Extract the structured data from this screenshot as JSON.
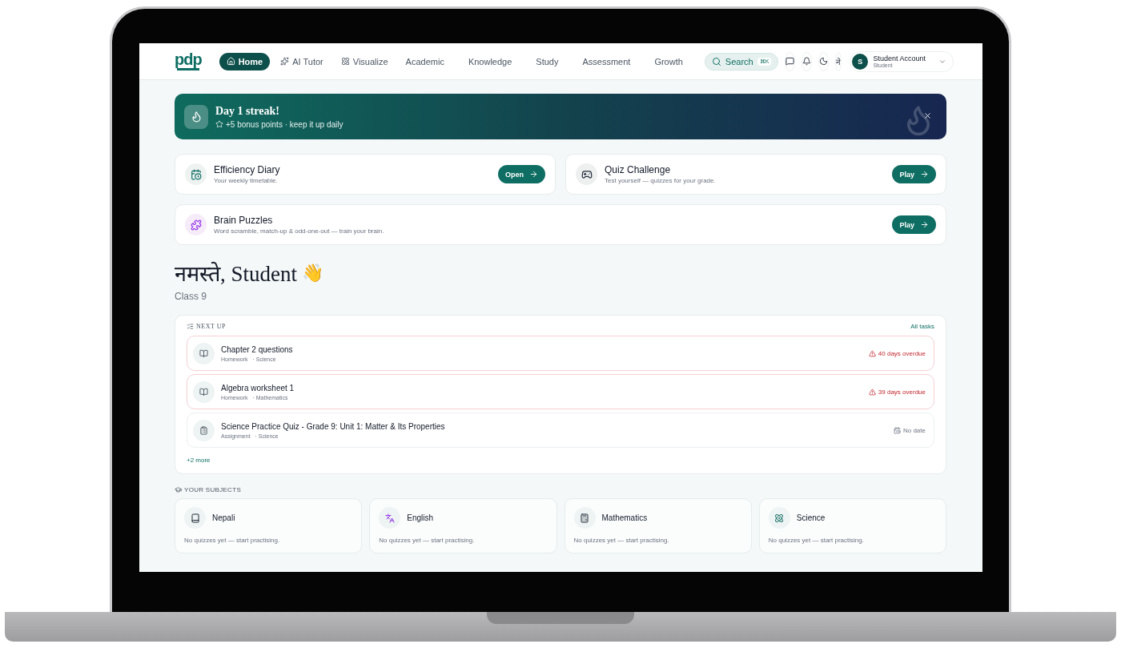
{
  "header": {
    "logo_text": "pdp",
    "nav": [
      {
        "label": "Home",
        "selected": true
      },
      {
        "label": "AI Tutor",
        "selected": false
      },
      {
        "label": "Visualize",
        "selected": false
      },
      {
        "label": "Academic",
        "selected": false
      },
      {
        "label": "Knowledge",
        "selected": false
      },
      {
        "label": "Study",
        "selected": false
      },
      {
        "label": "Assessment",
        "selected": false
      },
      {
        "label": "Growth",
        "selected": false
      }
    ],
    "search": {
      "label": "Search",
      "shortcut": "⌘K"
    },
    "language_toggle": "ने",
    "account": {
      "initial": "S",
      "name": "Student Account",
      "role": "Student"
    }
  },
  "streak": {
    "title": "Day 1 streak!",
    "subtitle": "+5 bonus points · keep it up daily"
  },
  "activities": [
    {
      "title": "Efficiency Diary",
      "description": "Your weekly timetable.",
      "action": "Open"
    },
    {
      "title": "Quiz Challenge",
      "description": "Test yourself — quizzes for your grade.",
      "action": "Play"
    },
    {
      "title": "Brain Puzzles",
      "description": "Word scramble, match-up & odd-one-out — train your brain.",
      "action": "Play"
    }
  ],
  "greeting": {
    "title": "नमस्ते, Student",
    "emoji": "👋",
    "class": "Class 9"
  },
  "next_up": {
    "heading": "NEXT UP",
    "link": "All tasks",
    "tasks": [
      {
        "kind": "homework",
        "title": "Chapter 2 questions",
        "type": "Homework",
        "subject": "· Science",
        "due": "40 days overdue",
        "overdue": true
      },
      {
        "kind": "homework",
        "title": "Algebra worksheet 1",
        "type": "Homework",
        "subject": "· Mathematics",
        "due": "39 days overdue",
        "overdue": true
      },
      {
        "kind": "assignment",
        "title": "Science Practice Quiz - Grade 9: Unit 1: Matter & Its Properties",
        "type": "Assignment",
        "subject": "· Science",
        "due": "No date",
        "overdue": false
      }
    ],
    "more": "+2 more"
  },
  "subjects": {
    "heading": "YOUR SUBJECTS",
    "items": [
      {
        "name": "Nepali",
        "note": "No quizzes yet — start practising."
      },
      {
        "name": "English",
        "note": "No quizzes yet — start practising."
      },
      {
        "name": "Mathematics",
        "note": "No quizzes yet — start practising."
      },
      {
        "name": "Science",
        "note": "No quizzes yet — start practising."
      }
    ]
  }
}
